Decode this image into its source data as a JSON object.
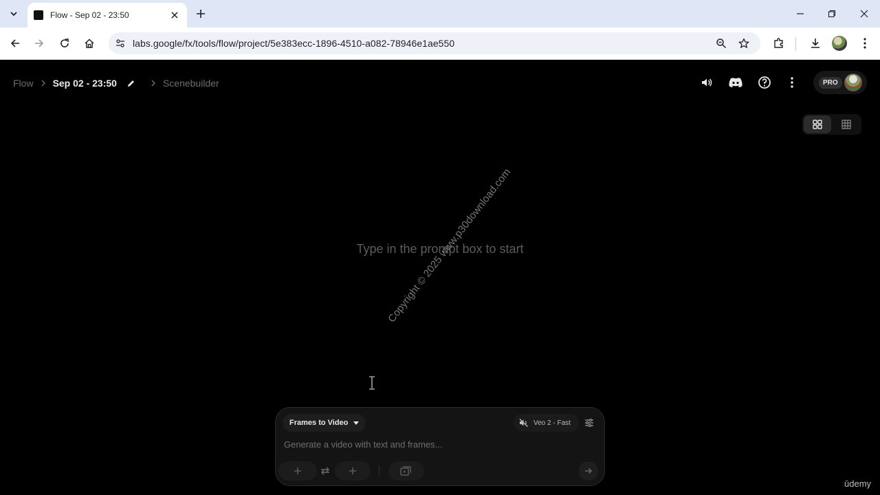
{
  "browser": {
    "tab_title": "Flow - Sep 02 - 23:50",
    "url": "labs.google/fx/tools/flow/project/5e383ecc-1896-4510-a082-78946e1ae550",
    "icons": [
      "tab-search-icon",
      "close-icon",
      "plus-icon",
      "minimize-icon",
      "restore-icon",
      "back-icon",
      "forward-icon",
      "reload-icon",
      "home-icon",
      "site-info-icon",
      "zoom-icon",
      "star-icon",
      "extensions-icon",
      "download-icon",
      "kebab-icon"
    ]
  },
  "header": {
    "breadcrumb": {
      "root": "Flow",
      "project": "Sep 02 - 23:50",
      "scene": "Scenebuilder"
    },
    "pro_badge": "PRO"
  },
  "main": {
    "empty_message": "Type in the prompt box to start",
    "watermark": "Copyright © 2025 www.p30download.com"
  },
  "prompt": {
    "mode": "Frames to Video",
    "model": "Veo 2 - Fast",
    "placeholder": "Generate a video with text and frames..."
  },
  "footer": {
    "brand": "ūdemy"
  },
  "colors": {
    "app_bg": "#000000",
    "browser_tabbar": "#dfe7f7",
    "prompt_bg": "#141414"
  }
}
